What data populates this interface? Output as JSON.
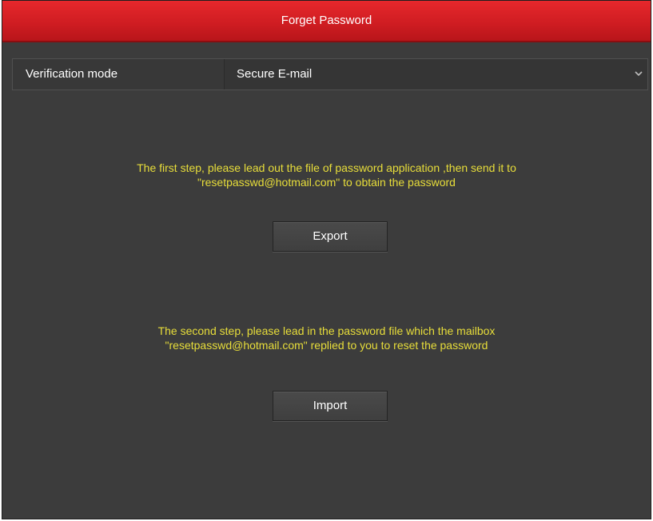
{
  "dialog": {
    "title": "Forget Password"
  },
  "verification": {
    "label": "Verification mode",
    "selected": "Secure E-mail"
  },
  "step1": {
    "line1": "The first step, please lead out the file of password application ,then send it to",
    "line2": "\"resetpasswd@hotmail.com\" to obtain the password",
    "button_label": "Export"
  },
  "step2": {
    "line1": "The second step, please lead in the password file which the mailbox",
    "line2": "\"resetpasswd@hotmail.com\" replied to you to reset the password",
    "button_label": "Import"
  },
  "colors": {
    "title_bar": "#d01d22",
    "panel_bg": "#3c3c3c",
    "step_text": "#e8de3a"
  },
  "icons": {
    "dropdown": "chevron-down-icon"
  }
}
